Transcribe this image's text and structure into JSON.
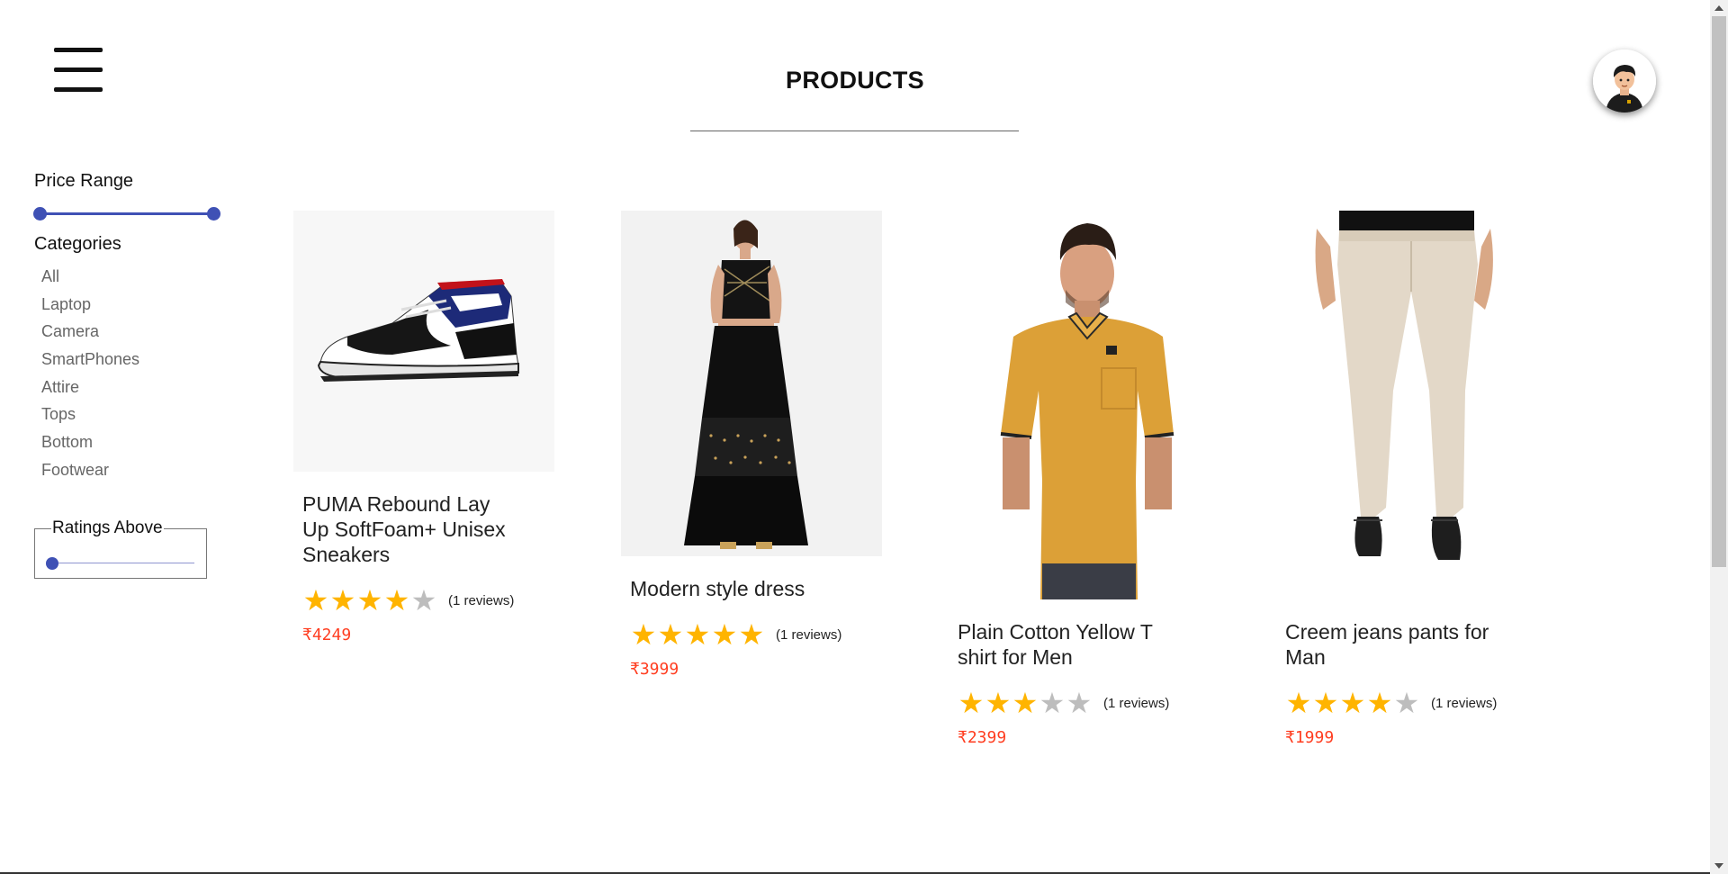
{
  "header": {
    "title": "PRODUCTS"
  },
  "sidebar": {
    "price_range_title": "Price Range",
    "categories_title": "Categories",
    "categories": [
      "All",
      "Laptop",
      "Camera",
      "SmartPhones",
      "Attire",
      "Tops",
      "Bottom",
      "Footwear"
    ],
    "ratings_title": "Ratings Above",
    "ratings_value": 0
  },
  "products": [
    {
      "name": "PUMA Rebound Lay Up SoftFoam+ Unisex Sneakers",
      "rating": 4,
      "reviews": "(1 reviews)",
      "price": "₹4249"
    },
    {
      "name": "Modern style dress",
      "rating": 5,
      "reviews": "(1 reviews)",
      "price": "₹3999"
    },
    {
      "name": "Plain Cotton Yellow T shirt for Men",
      "rating": 3,
      "reviews": "(1 reviews)",
      "price": "₹2399"
    },
    {
      "name": "Creem jeans pants for Man",
      "rating": 4,
      "reviews": "(1 reviews)",
      "price": "₹1999"
    }
  ],
  "colors": {
    "accent": "#3f51b5",
    "star": "#ffb400",
    "star_off": "#bdbdbd",
    "price": "#ff3d20"
  }
}
